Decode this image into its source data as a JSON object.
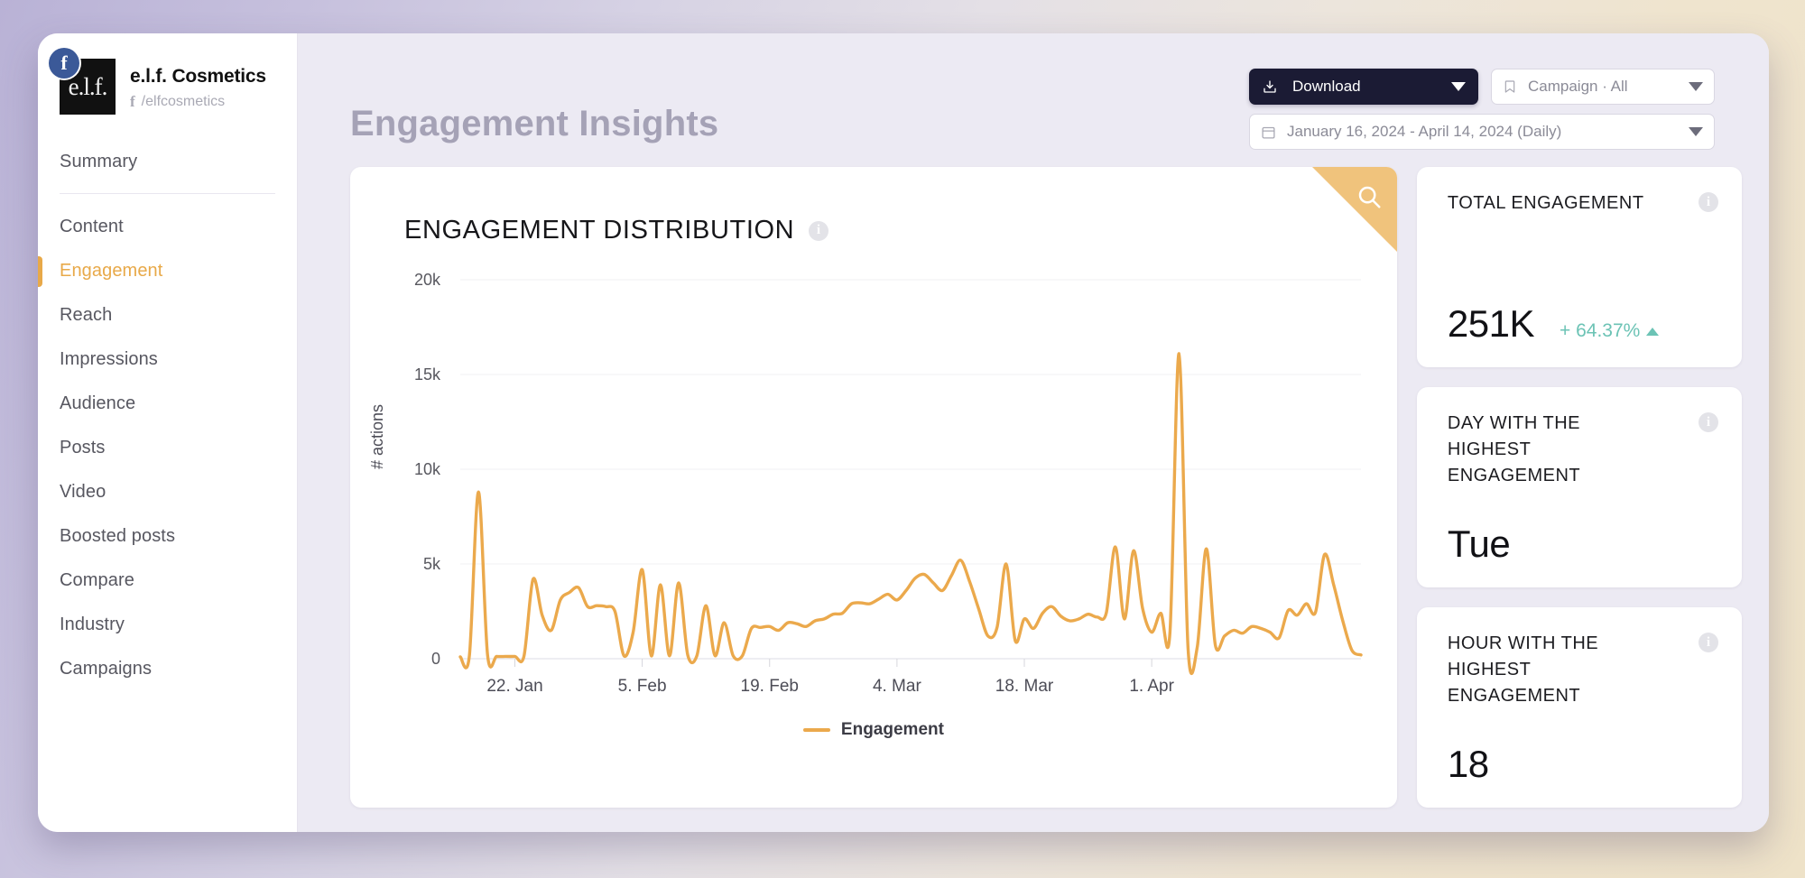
{
  "sidebar": {
    "brand": {
      "name": "e.l.f. Cosmetics",
      "handle": "/elfcosmetics",
      "logo_text": "e.l.f.",
      "network_badge": "f",
      "handle_glyph": "f"
    },
    "items": [
      {
        "label": "Summary",
        "active": false
      },
      {
        "label": "Content",
        "active": false
      },
      {
        "label": "Engagement",
        "active": true
      },
      {
        "label": "Reach",
        "active": false
      },
      {
        "label": "Impressions",
        "active": false
      },
      {
        "label": "Audience",
        "active": false
      },
      {
        "label": "Posts",
        "active": false
      },
      {
        "label": "Video",
        "active": false
      },
      {
        "label": "Boosted posts",
        "active": false
      },
      {
        "label": "Compare",
        "active": false
      },
      {
        "label": "Industry",
        "active": false
      },
      {
        "label": "Campaigns",
        "active": false
      }
    ]
  },
  "header": {
    "title": "Engagement Insights",
    "download_label": "Download",
    "campaign_filter": "Campaign · All",
    "date_range": "January 16, 2024 - April 14, 2024 (Daily)"
  },
  "chart_card": {
    "title": "ENGAGEMENT DISTRIBUTION",
    "info_glyph": "i"
  },
  "stats": [
    {
      "label": "TOTAL ENGAGEMENT",
      "value": "251K",
      "delta": "+ 64.37%",
      "delta_direction": "up",
      "delta_color": "#6cc3b5",
      "info_glyph": "i"
    },
    {
      "label": "DAY WITH THE HIGHEST ENGAGEMENT",
      "value": "Tue",
      "delta": "",
      "info_glyph": "i"
    },
    {
      "label": "HOUR WITH THE HIGHEST ENGAGEMENT",
      "value": "18",
      "delta": "",
      "info_glyph": "i"
    }
  ],
  "colors": {
    "accent_orange": "#eba94c",
    "badge_orange": "#f0c37c",
    "teal": "#6cc3b5",
    "dark_navy": "#1b1b34"
  },
  "chart_data": {
    "type": "line",
    "title": "ENGAGEMENT DISTRIBUTION",
    "xlabel": "",
    "ylabel": "# actions",
    "ylim": [
      0,
      20000
    ],
    "yticks": [
      0,
      5000,
      10000,
      15000,
      20000
    ],
    "yticklabels": [
      "0",
      "5k",
      "10k",
      "15k",
      "20k"
    ],
    "grid": true,
    "legend_position": "bottom-center",
    "xticklabels": [
      "22. Jan",
      "5. Feb",
      "19. Feb",
      "4. Mar",
      "18. Mar",
      "1. Apr"
    ],
    "xtick_indices": [
      6,
      20,
      34,
      48,
      62,
      76
    ],
    "x_start": "2024-01-16",
    "x_end": "2024-04-14",
    "series": [
      {
        "name": "Engagement",
        "color": "#eba94c",
        "values": [
          100,
          150,
          8800,
          200,
          120,
          120,
          120,
          130,
          4200,
          2300,
          1500,
          3100,
          3500,
          3750,
          2750,
          2800,
          2750,
          2500,
          150,
          1400,
          4700,
          150,
          3900,
          150,
          4000,
          200,
          150,
          2800,
          160,
          1900,
          150,
          150,
          1600,
          1650,
          1700,
          1500,
          1900,
          1850,
          1700,
          2000,
          2100,
          2350,
          2400,
          2900,
          2950,
          2900,
          3150,
          3400,
          3100,
          3600,
          4250,
          4450,
          4000,
          3600,
          4400,
          5200,
          4050,
          2600,
          1200,
          1650,
          5000,
          950,
          2100,
          1600,
          2400,
          2750,
          2250,
          2000,
          2100,
          2350,
          2200,
          2400,
          5900,
          2100,
          5700,
          2650,
          1400,
          2400,
          1350,
          16100,
          500,
          600,
          5800,
          700,
          1200,
          1500,
          1350,
          1700,
          1600,
          1400,
          1100,
          2550,
          2300,
          2900,
          2450,
          5500,
          3900,
          2000,
          450,
          200
        ]
      }
    ]
  }
}
